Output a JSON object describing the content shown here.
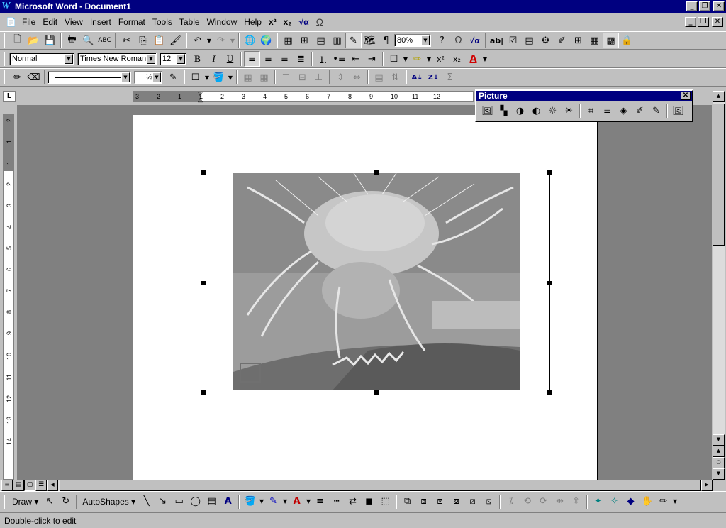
{
  "window": {
    "title": "Microsoft Word - Document1"
  },
  "menu": [
    "File",
    "Edit",
    "View",
    "Insert",
    "Format",
    "Tools",
    "Table",
    "Window",
    "Help"
  ],
  "menu_extras": {
    "superscript": "x²",
    "subscript": "x₂",
    "equation": "√α",
    "symbol": "Ω"
  },
  "standard_toolbar": {
    "zoom": "80%"
  },
  "formatting_toolbar": {
    "style": "Normal",
    "font": "Times New Roman",
    "size": "12"
  },
  "drawing_lines_toolbar": {
    "line_weight": "½"
  },
  "picture_toolbar": {
    "title": "Picture"
  },
  "draw_toolbar": {
    "draw_label": "Draw",
    "autoshapes_label": "AutoShapes"
  },
  "status": {
    "text": "Double-click to edit"
  },
  "ruler_h": [
    "3",
    "2",
    "1",
    "1",
    "2",
    "3",
    "4",
    "5",
    "6",
    "7",
    "8",
    "9",
    "10",
    "11",
    "12"
  ],
  "ruler_v": [
    "2",
    "1",
    "1",
    "2",
    "3",
    "4",
    "5",
    "6",
    "7",
    "8",
    "9",
    "10",
    "11",
    "12",
    "13",
    "14"
  ],
  "icons": {
    "accent": "#000080"
  }
}
